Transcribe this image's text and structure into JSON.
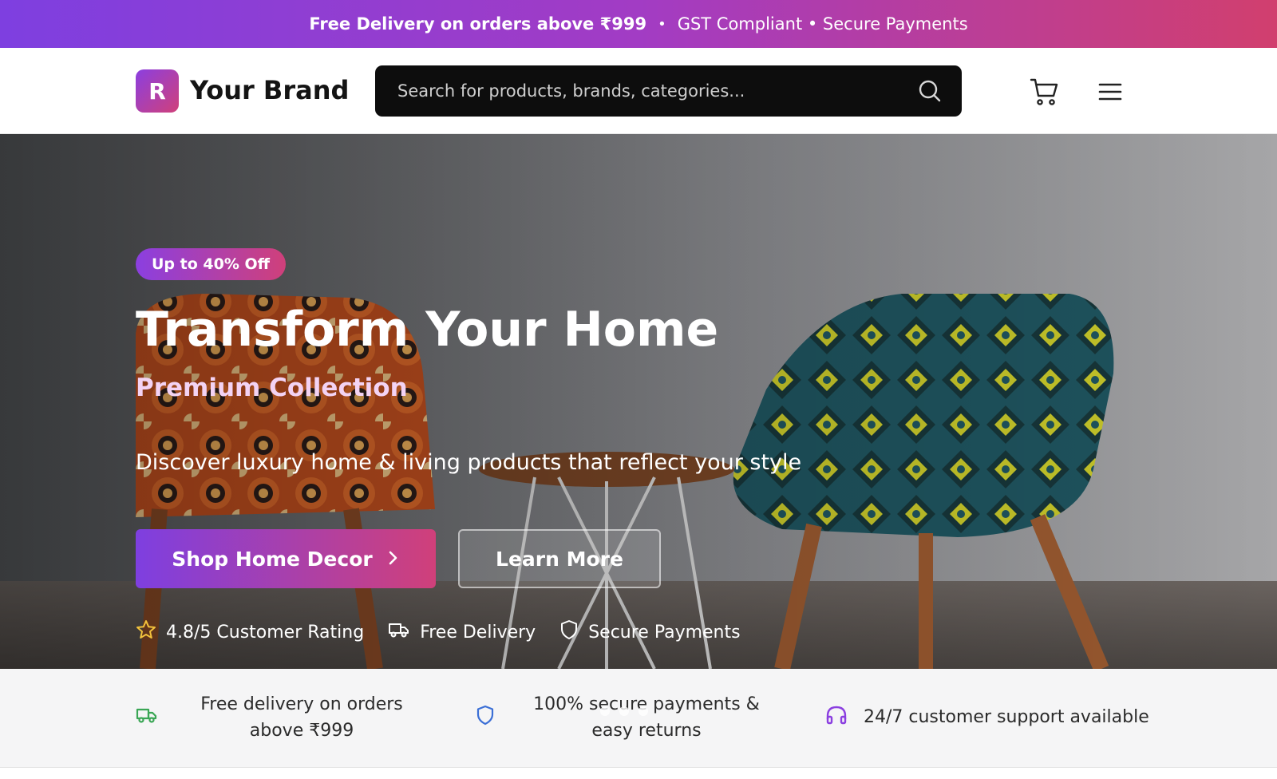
{
  "announcement": {
    "highlight": "Free Delivery on orders above ₹999",
    "separator": "•",
    "rest": "GST Compliant • Secure Payments"
  },
  "header": {
    "logo_letter": "R",
    "brand_name": "Your Brand",
    "search_placeholder": "Search for products, brands, categories...",
    "icons": [
      "search-icon",
      "cart-icon",
      "menu-icon"
    ]
  },
  "hero": {
    "badge": "Up to 40% Off",
    "title": "Transform Your Home",
    "subtitle": "Premium Collection",
    "description": "Discover luxury home & living products that reflect your style",
    "primary_button": "Shop Home Decor",
    "secondary_button": "Learn More",
    "trust": [
      {
        "icon": "star-icon",
        "label": "4.8/5 Customer Rating"
      },
      {
        "icon": "truck-icon",
        "label": "Free Delivery"
      },
      {
        "icon": "shield-icon",
        "label": "Secure Payments"
      }
    ]
  },
  "features": [
    {
      "icon": "truck-icon",
      "text": "Free delivery on orders above ₹999",
      "color": "#3aa655"
    },
    {
      "icon": "shield-icon",
      "text": "100% secure payments & easy returns",
      "color": "#3b6fd6"
    },
    {
      "icon": "headphones-icon",
      "text": "24/7 customer support available",
      "color": "#8b3fe0"
    }
  ],
  "colors": {
    "brand_gradient_start": "#7e3fe0",
    "brand_gradient_end": "#d0407a",
    "search_bg": "#0d0d0d"
  }
}
